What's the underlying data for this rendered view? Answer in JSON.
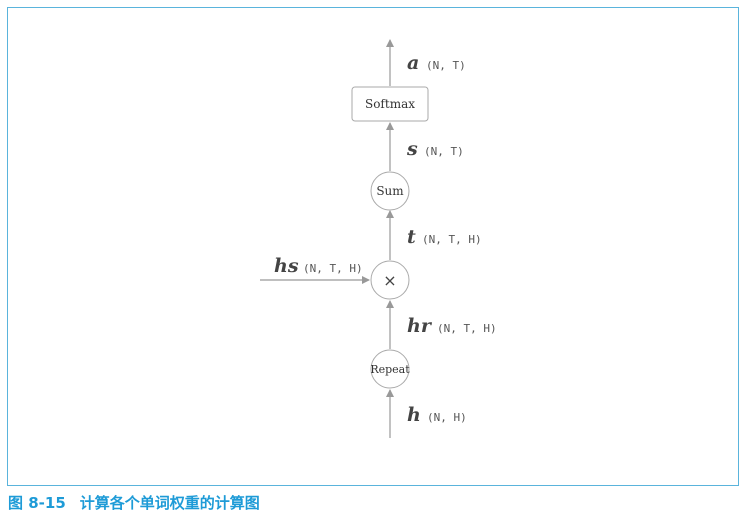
{
  "caption": {
    "label": "图 8-15",
    "text": "计算各个单词权重的计算图"
  },
  "diagram": {
    "nodes": {
      "softmax": "Softmax",
      "sum": "Sum",
      "multiply": "×",
      "repeat": "Repeat"
    },
    "edges": {
      "a": {
        "var": "a",
        "shape": "(N, T)"
      },
      "s": {
        "var": "s",
        "shape": "(N, T)"
      },
      "t": {
        "var": "t",
        "shape": "(N, T, H)"
      },
      "hs": {
        "var": "hs",
        "shape": "(N, T, H)"
      },
      "hr": {
        "var": "hr",
        "shape": "(N, T, H)"
      },
      "h": {
        "var": "h",
        "shape": "(N, H)"
      }
    }
  },
  "colors": {
    "frame": "#5ab4dc",
    "caption": "#1e9bd7",
    "line": "#999999"
  }
}
